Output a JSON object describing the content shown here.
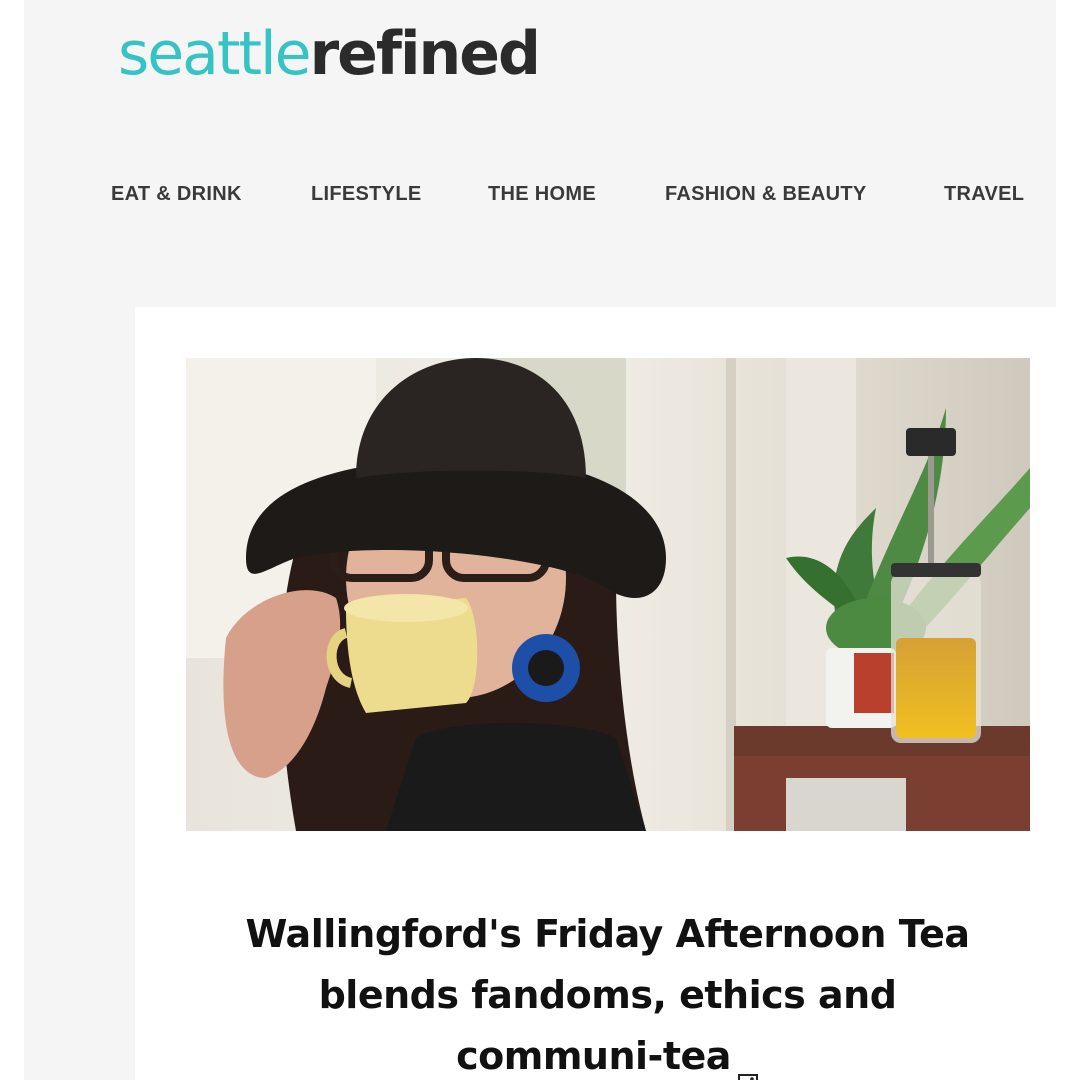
{
  "brand": {
    "logo_light": "seattle",
    "logo_bold": "refined",
    "accent_color": "#35c3c4",
    "dark_color": "#2b2b2b"
  },
  "nav": {
    "items": [
      {
        "label": "EAT & DRINK"
      },
      {
        "label": "LIFESTYLE"
      },
      {
        "label": "THE HOME"
      },
      {
        "label": "FASHION & BEAUTY"
      },
      {
        "label": "TRAVEL"
      }
    ]
  },
  "article": {
    "headline_line1": "Wallingford's Friday Afternoon Tea",
    "headline_line2": "blends fandoms, ethics and",
    "headline_line3": "communi-tea",
    "headline_icon": "image-icon",
    "hero_image": {
      "icon": "photo",
      "description_subjects": [
        "woman-in-black-hat",
        "yellow-teacup",
        "blue-earring",
        "plant",
        "tea-press"
      ]
    }
  }
}
